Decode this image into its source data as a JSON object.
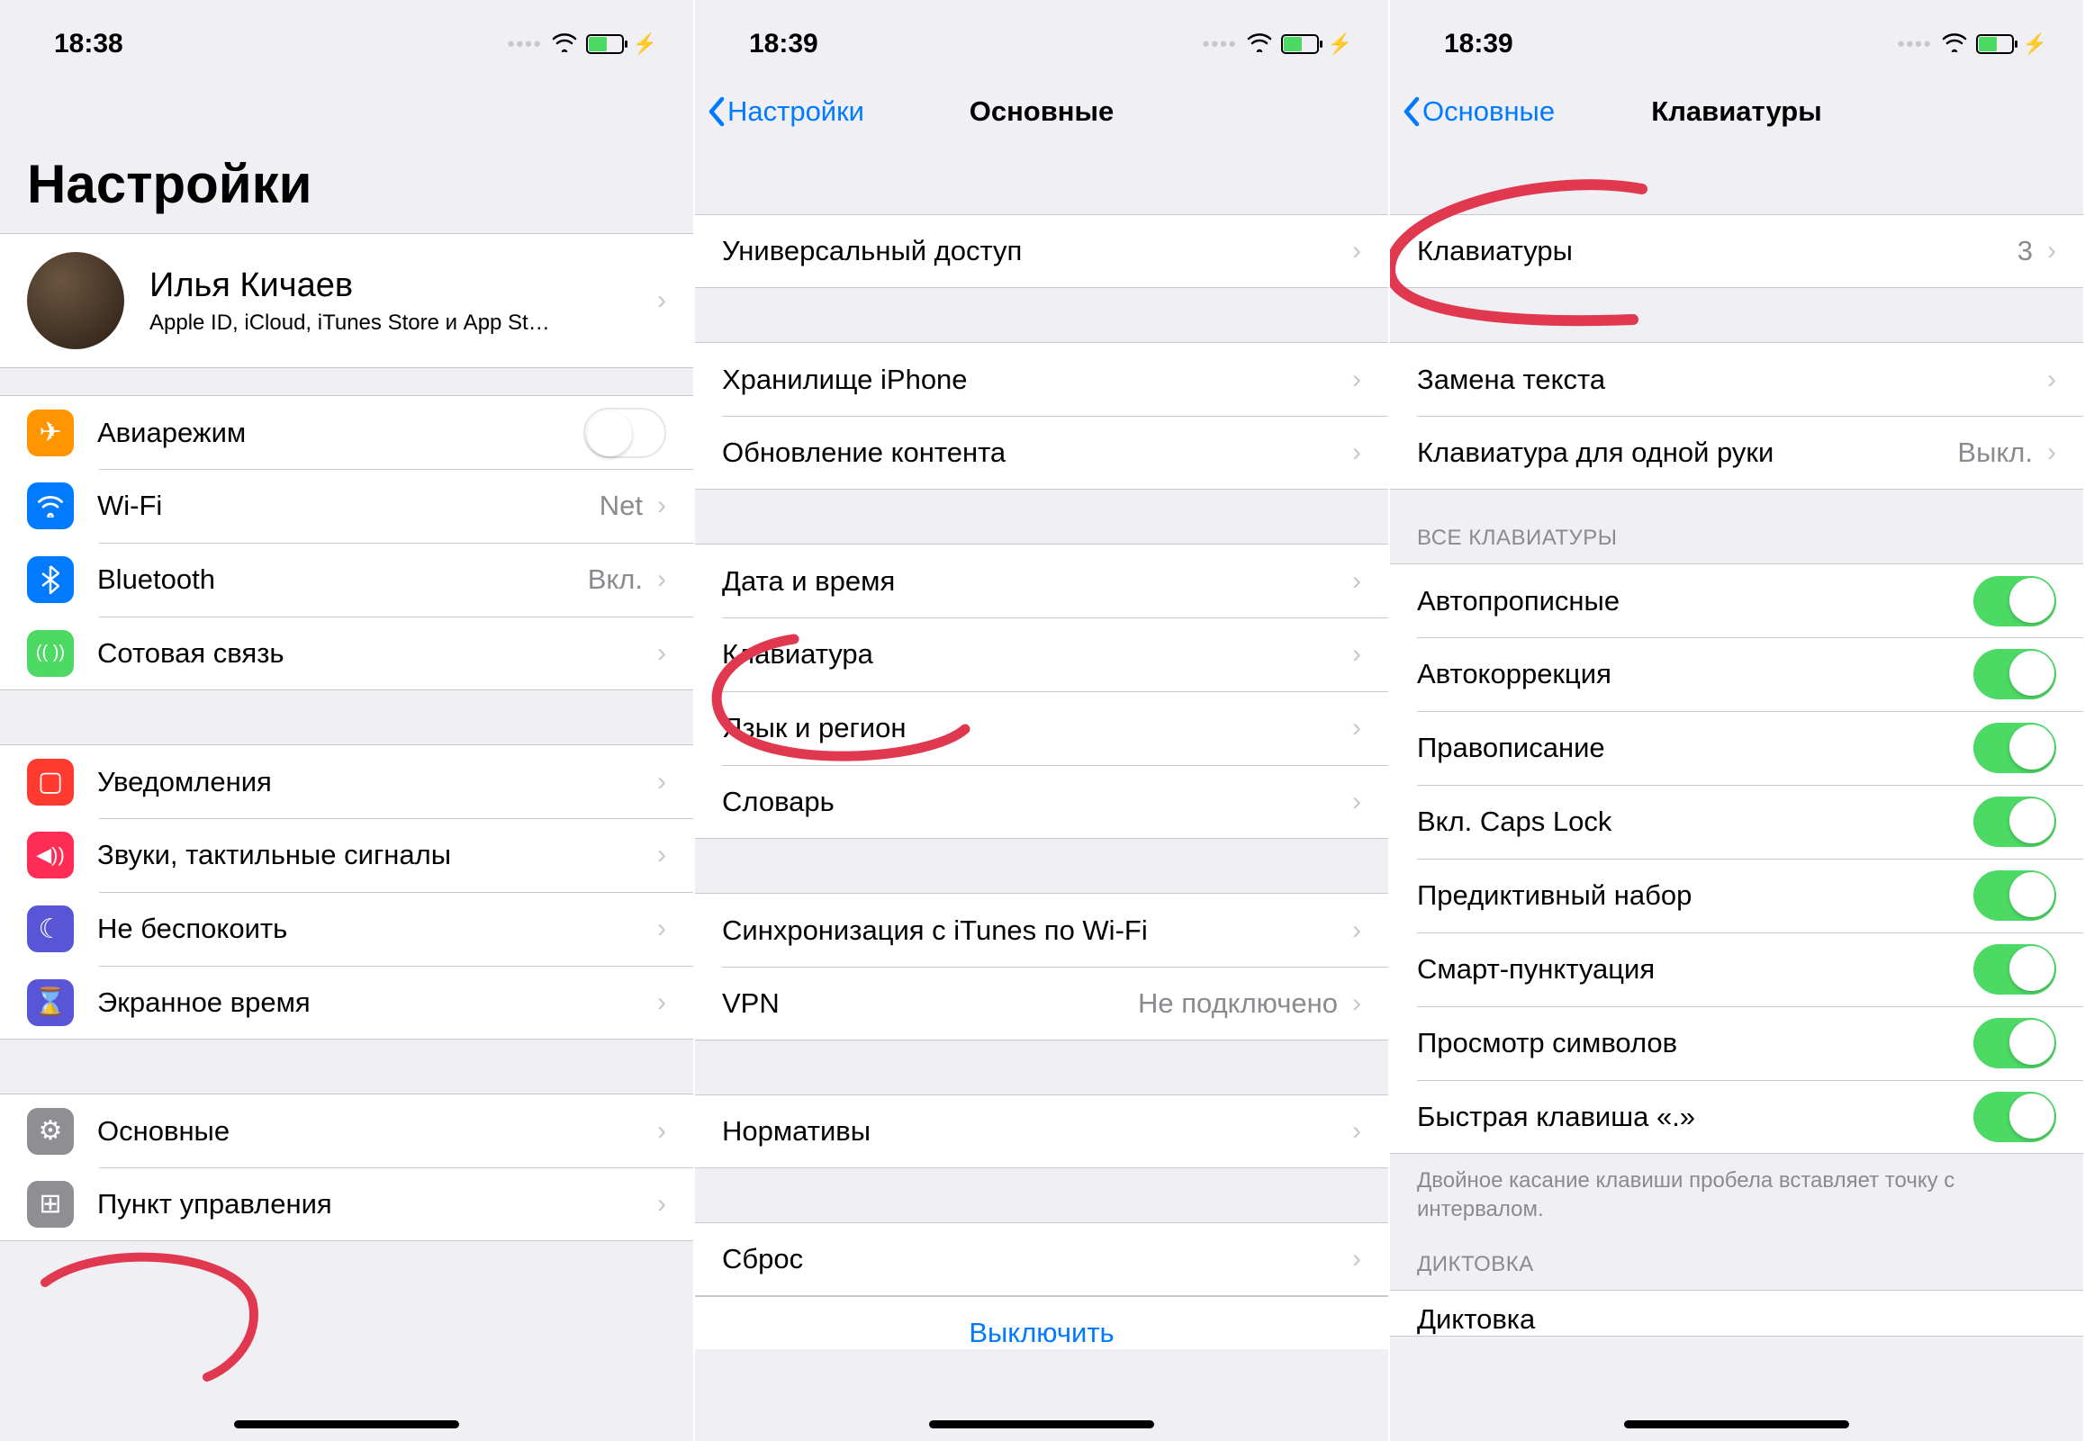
{
  "screen1": {
    "status": {
      "time": "18:38"
    },
    "title": "Настройки",
    "profile": {
      "name": "Илья Кичаев",
      "sub": "Apple ID, iCloud, iTunes Store и App St…"
    },
    "rows_network": [
      {
        "icon": "✈",
        "color": "#ff9500",
        "label": "Авиарежим",
        "toggle": false
      },
      {
        "icon": "wifi",
        "color": "#007aff",
        "label": "Wi-Fi",
        "value": "Net"
      },
      {
        "icon": "✱",
        "color": "#007aff",
        "label": "Bluetooth",
        "value": "Вкл."
      },
      {
        "icon": "((·))",
        "color": "#4cd964",
        "label": "Сотовая связь"
      }
    ],
    "rows_notif": [
      {
        "icon": "■",
        "color": "#ff3b30",
        "label": "Уведомления"
      },
      {
        "icon": "◀))",
        "color": "#ff2d55",
        "label": "Звуки, тактильные сигналы"
      },
      {
        "icon": "☾",
        "color": "#5856d6",
        "label": "Не беспокоить"
      },
      {
        "icon": "⌛",
        "color": "#5856d6",
        "label": "Экранное время"
      }
    ],
    "rows_general": [
      {
        "icon": "⚙",
        "color": "#8e8e93",
        "label": "Основные"
      },
      {
        "icon": "⊞",
        "color": "#8e8e93",
        "label": "Пункт управления"
      }
    ]
  },
  "screen2": {
    "status": {
      "time": "18:39"
    },
    "nav": {
      "back": "Настройки",
      "title": "Основные"
    },
    "group1": [
      {
        "label": "Универсальный доступ"
      }
    ],
    "group2": [
      {
        "label": "Хранилище iPhone"
      },
      {
        "label": "Обновление контента"
      }
    ],
    "group3": [
      {
        "label": "Дата и время"
      },
      {
        "label": "Клавиатура"
      },
      {
        "label": "Язык и регион"
      },
      {
        "label": "Словарь"
      }
    ],
    "group4": [
      {
        "label": "Синхронизация с iTunes по Wi-Fi"
      },
      {
        "label": "VPN",
        "value": "Не подключено"
      }
    ],
    "group5": [
      {
        "label": "Нормативы"
      }
    ],
    "group6": [
      {
        "label": "Сброс"
      }
    ],
    "shutdown": "Выключить"
  },
  "screen3": {
    "status": {
      "time": "18:39"
    },
    "nav": {
      "back": "Основные",
      "title": "Клавиатуры"
    },
    "group1": [
      {
        "label": "Клавиатуры",
        "value": "3"
      }
    ],
    "group2": [
      {
        "label": "Замена текста"
      },
      {
        "label": "Клавиатура для одной руки",
        "value": "Выкл."
      }
    ],
    "section_header": "ВСЕ КЛАВИАТУРЫ",
    "toggles": [
      {
        "label": "Автопрописные",
        "on": true
      },
      {
        "label": "Автокоррекция",
        "on": true
      },
      {
        "label": "Правописание",
        "on": true
      },
      {
        "label": "Вкл. Caps Lock",
        "on": true
      },
      {
        "label": "Предиктивный набор",
        "on": true
      },
      {
        "label": "Смарт-пунктуация",
        "on": true
      },
      {
        "label": "Просмотр символов",
        "on": true
      },
      {
        "label": "Быстрая клавиша «.»",
        "on": true
      }
    ],
    "footer": "Двойное касание клавиши пробела вставляет точку с интервалом.",
    "dictation_header": "ДИКТОВКА",
    "dictation_row": {
      "label": "Диктовка"
    }
  }
}
